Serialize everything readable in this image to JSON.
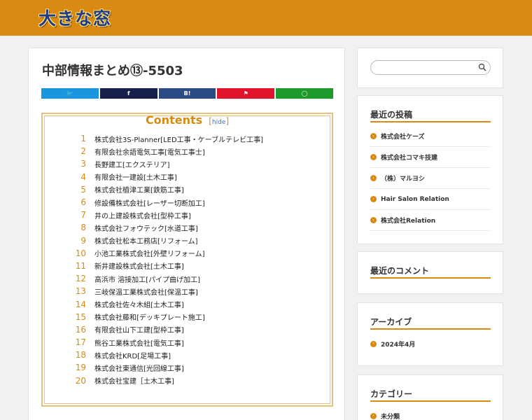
{
  "header": {
    "logo_text": "大きな窓",
    "color": "#d98a12"
  },
  "article": {
    "title": "中部情報まとめ⑬-5503",
    "share": [
      {
        "name": "twitter",
        "label": "🐦",
        "color": "#1b95e0"
      },
      {
        "name": "facebook",
        "label": "f",
        "color": "#17204d"
      },
      {
        "name": "hatena",
        "label": "B!",
        "color": "#2a4b85"
      },
      {
        "name": "pocket",
        "label": "⚑",
        "color": "#e0142a"
      },
      {
        "name": "line",
        "label": "◯",
        "color": "#1e9a2c"
      }
    ],
    "toc": {
      "title": "Contents",
      "hide_label": "hide",
      "items": [
        {
          "num": "1",
          "text": "株式会社3S-Planner[LED工事・ケーブルテレビ工事]"
        },
        {
          "num": "2",
          "text": "有限会社余語電気工事[電気工事士]"
        },
        {
          "num": "3",
          "text": "長野建工[エクステリア]"
        },
        {
          "num": "4",
          "text": "有限会社一建設[土木工事]"
        },
        {
          "num": "5",
          "text": "株式会社植津工業[鉄筋工事]"
        },
        {
          "num": "6",
          "text": "修設備株式会社[レーザー切断加工]"
        },
        {
          "num": "7",
          "text": "井の上建設株式会社[型枠工事]"
        },
        {
          "num": "8",
          "text": "株式会社フォウテック[水道工事]"
        },
        {
          "num": "9",
          "text": "株式会社松本工務店[リフォーム]"
        },
        {
          "num": "10",
          "text": "小池工業株式会社[外壁リフォーム]"
        },
        {
          "num": "11",
          "text": "新井建設株式会社[土木工事]"
        },
        {
          "num": "12",
          "text": "高浜市 溶接加工[パイプ曲げ加工]"
        },
        {
          "num": "13",
          "text": "三岐保温工業株式会社[保温工事]"
        },
        {
          "num": "14",
          "text": "株式会社佐々木組[土木工事]"
        },
        {
          "num": "15",
          "text": "株式会社藤和[デッキプレート施工]"
        },
        {
          "num": "16",
          "text": "有限会社山下工建[型枠工事]"
        },
        {
          "num": "17",
          "text": "熊谷工業株式会社[電気工事]"
        },
        {
          "num": "18",
          "text": "株式会社KRD[足場工事]"
        },
        {
          "num": "19",
          "text": "株式会社東通信[光回線工事]"
        },
        {
          "num": "20",
          "text": "株式会社宝建［土木工事]"
        }
      ]
    }
  },
  "sidebar": {
    "search": {
      "placeholder": ""
    },
    "recent_posts": {
      "title": "最近の投稿",
      "items": [
        "株式会社ケーズ",
        "株式会社コマキ技建",
        "（株）マルヨシ",
        "Hair Salon Relation",
        "株式会社Relation"
      ]
    },
    "recent_comments": {
      "title": "最近のコメント"
    },
    "archives": {
      "title": "アーカイブ",
      "items": [
        "2024年4月"
      ]
    },
    "categories": {
      "title": "カテゴリー",
      "items": [
        "未分類"
      ]
    }
  }
}
